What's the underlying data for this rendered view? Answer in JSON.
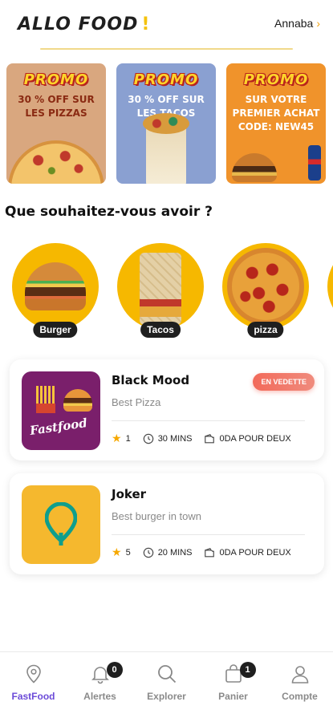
{
  "header": {
    "logo": "ALLO FOOD",
    "logo_mark": "!",
    "city": "Annaba",
    "city_chevron": "›"
  },
  "promos": [
    {
      "badge": "PROMO",
      "text": "30 % OFF SUR LES PIZZAS",
      "image": "pizza"
    },
    {
      "badge": "PROMO",
      "text": "30 % OFF SUR LES TACOS",
      "image": "tacos"
    },
    {
      "badge": "PROMO",
      "text": "SUR VOTRE PREMIER ACHAT CODE: NEW45",
      "image": "burger-soda"
    }
  ],
  "section_title": "Que souhaitez-vous avoir ?",
  "categories": [
    {
      "label": "Burger"
    },
    {
      "label": "Tacos"
    },
    {
      "label": "pizza"
    }
  ],
  "restaurants": [
    {
      "name": "Black Mood",
      "description": "Best Pizza",
      "tag": "EN VEDETTE",
      "logo_text": "Fastfood",
      "rating": "1",
      "time": "30 MINS",
      "delivery": "0DA POUR DEUX"
    },
    {
      "name": "Joker",
      "description": "Best burger in town",
      "rating": "5",
      "time": "20 MINS",
      "delivery": "0DA POUR DEUX"
    }
  ],
  "nav": {
    "items": [
      {
        "label": "FastFood",
        "icon": "location-pin-icon",
        "active": true
      },
      {
        "label": "Alertes",
        "icon": "bell-icon",
        "badge": "0"
      },
      {
        "label": "Explorer",
        "icon": "search-icon"
      },
      {
        "label": "Panier",
        "icon": "bag-icon",
        "badge": "1"
      },
      {
        "label": "Compte",
        "icon": "user-icon"
      }
    ]
  },
  "colors": {
    "accent": "#f6b800",
    "active_nav": "#6c4bd8",
    "tag": "#f26a5a"
  }
}
